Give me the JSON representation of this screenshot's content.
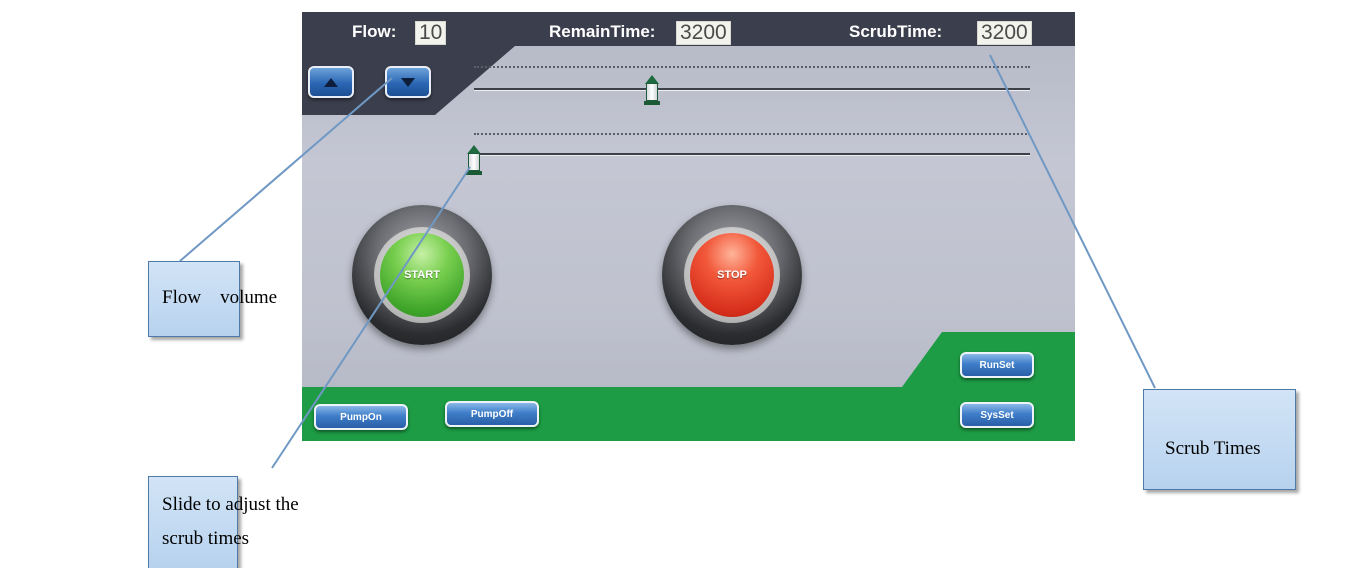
{
  "header": {
    "flow_label": "Flow:",
    "flow_value": "10",
    "remain_label": "RemainTime:",
    "remain_value": "3200",
    "scrub_label": "ScrubTime:",
    "scrub_value": "3200"
  },
  "controls": {
    "up_icon": "triangle-up-icon",
    "down_icon": "triangle-down-icon",
    "start_label": "START",
    "stop_label": "STOP",
    "pump_on_label": "PumpOn",
    "pump_off_label": "PumpOff",
    "run_set_label": "RunSet",
    "sys_set_label": "SysSet"
  },
  "sliders": {
    "scrub_time_position": 0.32,
    "scrub_times_position": 0.0
  },
  "annotations": {
    "flow_volume": "Flow    volume",
    "slide_adjust_line1": "Slide to adjust the",
    "slide_adjust_line2": "scrub times",
    "scrub_times": "Scrub Times"
  },
  "colors": {
    "header_dark": "#3b3e4c",
    "footer_green": "#1d9c45",
    "start_green": "#4caf30",
    "stop_red": "#e03d22",
    "callout_fill": "#c5dbf2"
  }
}
